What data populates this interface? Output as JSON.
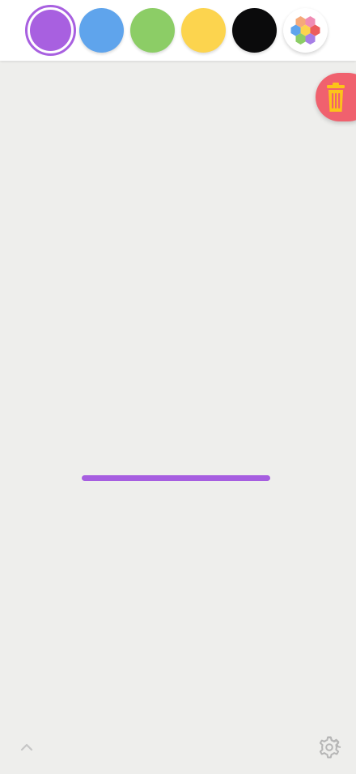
{
  "toolbar": {
    "colors": [
      {
        "name": "purple",
        "hex": "#a860e0",
        "selected": true
      },
      {
        "name": "blue",
        "hex": "#5fa4ec",
        "selected": false
      },
      {
        "name": "green",
        "hex": "#8ccd66",
        "selected": false
      },
      {
        "name": "yellow",
        "hex": "#fcd44e",
        "selected": false
      },
      {
        "name": "black",
        "hex": "#0b0b0c",
        "selected": false
      }
    ],
    "palette_icon": "hexagon-palette-icon"
  },
  "canvas": {
    "background": "#eeeeec",
    "stroke_color": "#a65ee0"
  },
  "actions": {
    "trash_icon": "trash-icon",
    "trash_color": "#f0616e",
    "collapse_icon": "chevron-up-icon",
    "settings_icon": "gear-icon"
  }
}
